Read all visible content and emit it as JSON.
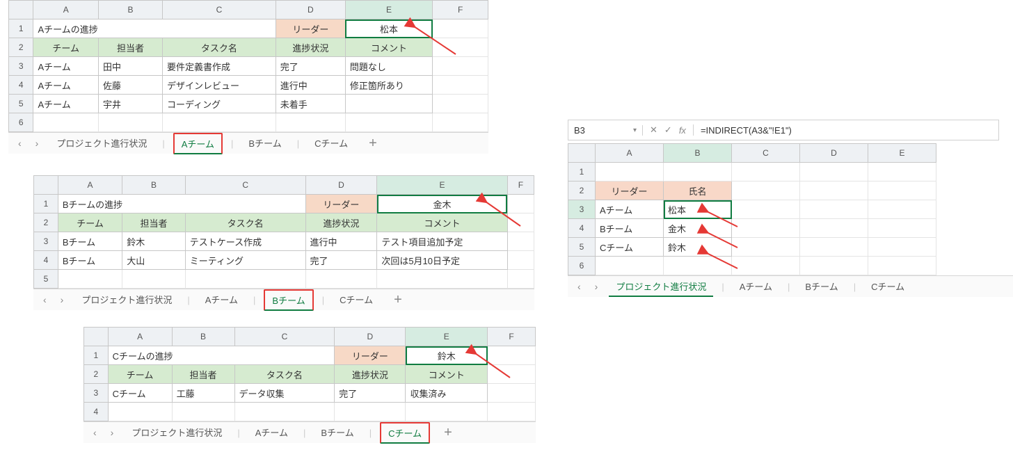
{
  "sheetA": {
    "cols": [
      "A",
      "B",
      "C",
      "D",
      "E",
      "F"
    ],
    "row1_title": "Aチームの進捗",
    "leader_label": "リーダー",
    "leader_name": "松本",
    "headers": {
      "team": "チーム",
      "person": "担当者",
      "task": "タスク名",
      "progress": "進捗状況",
      "comment": "コメント"
    },
    "rows": [
      {
        "team": "Aチーム",
        "person": "田中",
        "task": "要件定義書作成",
        "progress": "完了",
        "comment": "問題なし"
      },
      {
        "team": "Aチーム",
        "person": "佐藤",
        "task": "デザインレビュー",
        "progress": "進行中",
        "comment": "修正箇所あり"
      },
      {
        "team": "Aチーム",
        "person": "宇井",
        "task": "コーディング",
        "progress": "未着手",
        "comment": ""
      }
    ],
    "tabs": {
      "nav": "プロジェクト進行状況",
      "A": "Aチーム",
      "B": "Bチーム",
      "C": "Cチーム"
    }
  },
  "sheetB": {
    "cols": [
      "A",
      "B",
      "C",
      "D",
      "E",
      "F"
    ],
    "row1_title": "Bチームの進捗",
    "leader_label": "リーダー",
    "leader_name": "金木",
    "headers": {
      "team": "チーム",
      "person": "担当者",
      "task": "タスク名",
      "progress": "進捗状況",
      "comment": "コメント"
    },
    "rows": [
      {
        "team": "Bチーム",
        "person": "鈴木",
        "task": "テストケース作成",
        "progress": "進行中",
        "comment": "テスト項目追加予定"
      },
      {
        "team": "Bチーム",
        "person": "大山",
        "task": "ミーティング",
        "progress": "完了",
        "comment": "次回は5月10日予定"
      }
    ],
    "tabs": {
      "nav": "プロジェクト進行状況",
      "A": "Aチーム",
      "B": "Bチーム",
      "C": "Cチーム"
    }
  },
  "sheetC": {
    "cols": [
      "A",
      "B",
      "C",
      "D",
      "E",
      "F"
    ],
    "row1_title": "Cチームの進捗",
    "leader_label": "リーダー",
    "leader_name": "鈴木",
    "headers": {
      "team": "チーム",
      "person": "担当者",
      "task": "タスク名",
      "progress": "進捗状況",
      "comment": "コメント"
    },
    "rows": [
      {
        "team": "Cチーム",
        "person": "工藤",
        "task": "データ収集",
        "progress": "完了",
        "comment": "収集済み"
      }
    ],
    "tabs": {
      "nav": "プロジェクト進行状況",
      "A": "Aチーム",
      "B": "Bチーム",
      "C": "Cチーム"
    }
  },
  "summary": {
    "namebox": "B3",
    "formula": "=INDIRECT(A3&\"!E1\")",
    "cols": [
      "A",
      "B",
      "C",
      "D",
      "E"
    ],
    "headers": {
      "leader": "リーダー",
      "name": "氏名"
    },
    "rows": [
      {
        "team": "Aチーム",
        "name": "松本"
      },
      {
        "team": "Bチーム",
        "name": "金木"
      },
      {
        "team": "Cチーム",
        "name": "鈴木"
      }
    ],
    "tabs": {
      "nav": "プロジェクト進行状況",
      "A": "Aチーム",
      "B": "Bチーム",
      "C": "Cチーム"
    }
  }
}
